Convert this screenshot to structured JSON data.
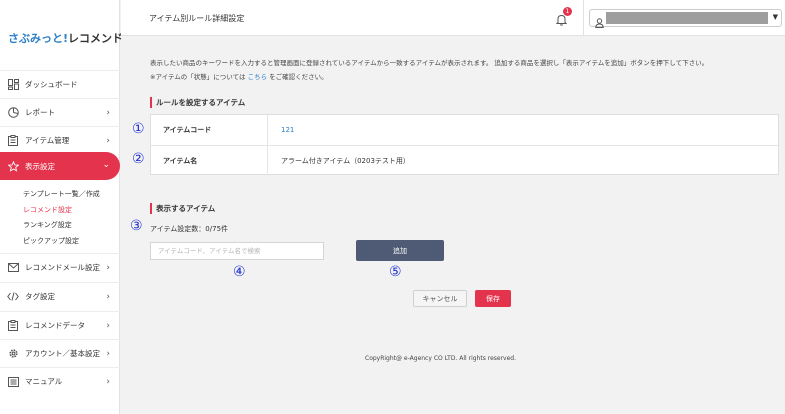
{
  "brand": {
    "part1": "さぶみっと!",
    "part2": "レコメンド"
  },
  "sidebar": {
    "items": [
      {
        "label": "ダッシュボード",
        "icon": "dashboard-icon"
      },
      {
        "label": "レポート",
        "icon": "pie-chart-icon"
      },
      {
        "label": "アイテム管理",
        "icon": "clipboard-icon"
      },
      {
        "label": "表示設定",
        "icon": "star-icon",
        "active": true
      },
      {
        "label": "レコメンドメール設定",
        "icon": "mail-icon"
      },
      {
        "label": "タグ設定",
        "icon": "code-icon"
      },
      {
        "label": "レコメンドデータ",
        "icon": "clipboard-list-icon"
      },
      {
        "label": "アカウント／基本設定",
        "icon": "gear-icon"
      },
      {
        "label": "マニュアル",
        "icon": "manual-icon"
      }
    ],
    "subitems": [
      "テンプレート一覧／作成",
      "レコメンド設定",
      "ランキング設定",
      "ピックアップ設定"
    ]
  },
  "header": {
    "title": "アイテム別ルール詳細設定",
    "notification_count": "1"
  },
  "description": {
    "line1": "表示したい商品のキーワードを入力すると管理画面に登録されているアイテムから一致するアイテムが表示されます。 追加する商品を選択し「表示アイテムを追加」ボタンを押下して下さい。",
    "line2_prefix": "※アイテムの「状態」については",
    "line2_link": "こちら",
    "line2_suffix": "をご確認ください。"
  },
  "rule_section": {
    "title": "ルールを設定するアイテム",
    "rows": [
      {
        "label": "アイテムコード",
        "value": "121"
      },
      {
        "label": "アイテム名",
        "value": "アラーム付きアイテム（0203テスト用）"
      }
    ]
  },
  "display_section": {
    "title": "表示するアイテム",
    "count": "アイテム設定数：0/75件",
    "search_placeholder": "アイテムコード、アイテム名で検索",
    "add_label": "追加"
  },
  "actions": {
    "cancel_label": "キャンセル",
    "save_label": "保存"
  },
  "annotations": [
    "①",
    "②",
    "③",
    "④",
    "⑤"
  ],
  "footer": "CopyRight@ e-Agency CO LTD. All rights reserved.",
  "colors": {
    "accent": "#e4344d",
    "link": "#2a7dc8",
    "button": "#4f5b75",
    "annotation": "#1f2fd6"
  }
}
